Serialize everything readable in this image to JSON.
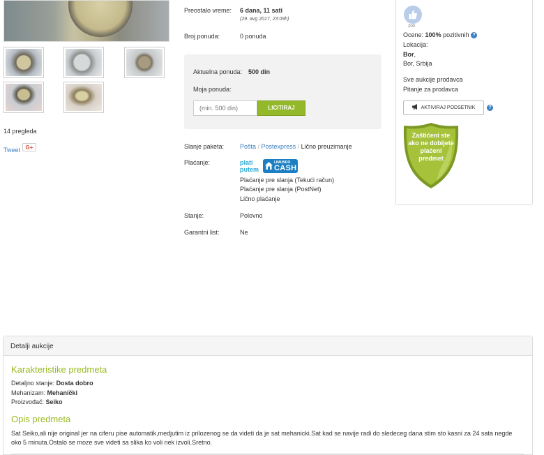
{
  "gallery": {
    "views": "14 pregleda",
    "tweet": "Tweet",
    "gplus": "G+"
  },
  "info": {
    "remaining_label": "Preostalo vreme:",
    "remaining_value": "6 dana, 11 sati",
    "remaining_date": "(29. avg 2017, 23:09h)",
    "bids_label": "Broj ponuda:",
    "bids_value": "0 ponuda",
    "current_bid_label": "Aktuelna ponuda:",
    "current_bid_value": "500 din",
    "my_bid_label": "Moja ponuda:",
    "bid_placeholder": "(min. 500 din)",
    "bid_button": "LICITIRAJ",
    "shipping_label": "Slanje paketa:",
    "shipping_options": [
      "Pošta",
      "Postexpress",
      "Lično preuzimanje"
    ],
    "payment_label": "Plaćanje:",
    "plati_putem": [
      "plati",
      "putem"
    ],
    "limundo_cash_top": "LIMUNDO",
    "limundo_cash": "CASH",
    "payment_methods": [
      "Plaćanje pre slanja (Tekući račun)",
      "Plaćanje pre slanja (PostNet)",
      "Lično plaćanje"
    ],
    "condition_label": "Stanje:",
    "condition_value": "Polovno",
    "warranty_label": "Garantni list:",
    "warranty_value": "Ne"
  },
  "seller": {
    "badge_number": "200",
    "rating_prefix": "Ocene:",
    "rating_value": "100%",
    "rating_suffix": "pozitivnih",
    "location_label": "Lokacija:",
    "location_city": "Bor",
    "location_full": "Bor, Srbija",
    "all_auctions": "Sve aukcije prodavca",
    "ask_seller": "Pitanje za prodavca",
    "activate_reminder": "AKTIVIRAJ PODSETNIK",
    "shield_text": [
      "Zaštićeni ste",
      "ako ne dobijete",
      "plaćeni",
      "predmet"
    ],
    "colors": {
      "shield": "#a6c23a",
      "shield_dark": "#7d9924",
      "badge": "#b9cdea"
    }
  },
  "details": {
    "header": "Detalji aukcije",
    "characteristics_title": "Karakteristike predmeta",
    "condition_label": "Detaljno stanje:",
    "condition_value": "Dosta dobro",
    "mechanism_label": "Mehanizam:",
    "mechanism_value": "Mehanički",
    "maker_label": "Proizvođač:",
    "maker_value": "Seiko",
    "description_title": "Opis predmeta",
    "description": "Sat Seiko,ali nije original jer na ciferu pise automatik,medjutim iz prilozenog se da videti da je sat mehanicki.Sat kad se navije radi do sledeceg dana stim sto kasni za 24 sata negde oko 5 minuta.Ostalo se moze sve videti sa slika ko voli nek izvoli.Sretno."
  },
  "colors": {
    "link": "#3a7fc1",
    "accent_green": "#9aba22",
    "button_green": "#93b82a"
  }
}
